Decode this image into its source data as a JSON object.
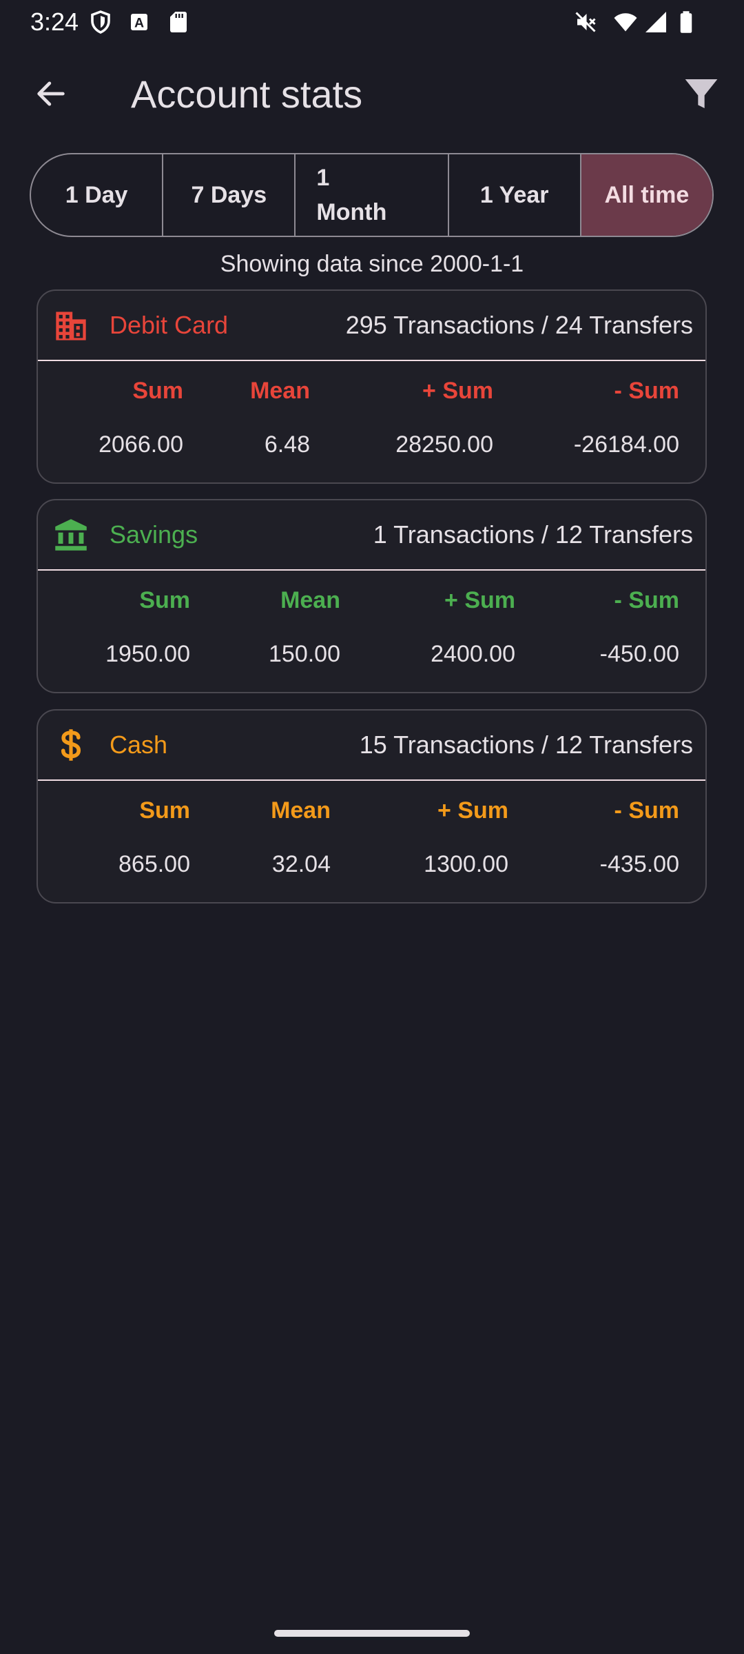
{
  "status_bar": {
    "time": "3:24",
    "icons": [
      "shield-icon",
      "a-badge-icon",
      "sd-card-icon",
      "mute-icon",
      "wifi-icon",
      "signal-icon",
      "battery-icon"
    ]
  },
  "app_bar": {
    "title": "Account stats",
    "back_icon": "arrow-back-icon",
    "filter_icon": "filter-icon"
  },
  "range_selector": {
    "options": [
      "1 Day",
      "7 Days",
      "1\nMonth",
      "1 Year",
      "All time"
    ],
    "selected": "All time",
    "selected_color": "#6b3a4a"
  },
  "range_caption": "Showing data since 2000-1-1",
  "accounts": [
    {
      "name": "Debit Card",
      "icon": "building-icon",
      "color": "#e8453a",
      "counts": "295 Transactions / 24 Transfers",
      "headers": [
        "Sum",
        "Mean",
        "+ Sum",
        "- Sum"
      ],
      "values": [
        "2066.00",
        "6.48",
        "28250.00",
        "-26184.00"
      ]
    },
    {
      "name": "Savings",
      "icon": "bank-icon",
      "color": "#4caf50",
      "counts": "1 Transactions / 12 Transfers",
      "headers": [
        "Sum",
        "Mean",
        "+ Sum",
        "- Sum"
      ],
      "values": [
        "1950.00",
        "150.00",
        "2400.00",
        "-450.00"
      ]
    },
    {
      "name": "Cash",
      "icon": "dollar-icon",
      "color": "#f39a1a",
      "counts": "15 Transactions / 12 Transfers",
      "headers": [
        "Sum",
        "Mean",
        "+ Sum",
        "- Sum"
      ],
      "values": [
        "865.00",
        "32.04",
        "1300.00",
        "-435.00"
      ]
    }
  ]
}
